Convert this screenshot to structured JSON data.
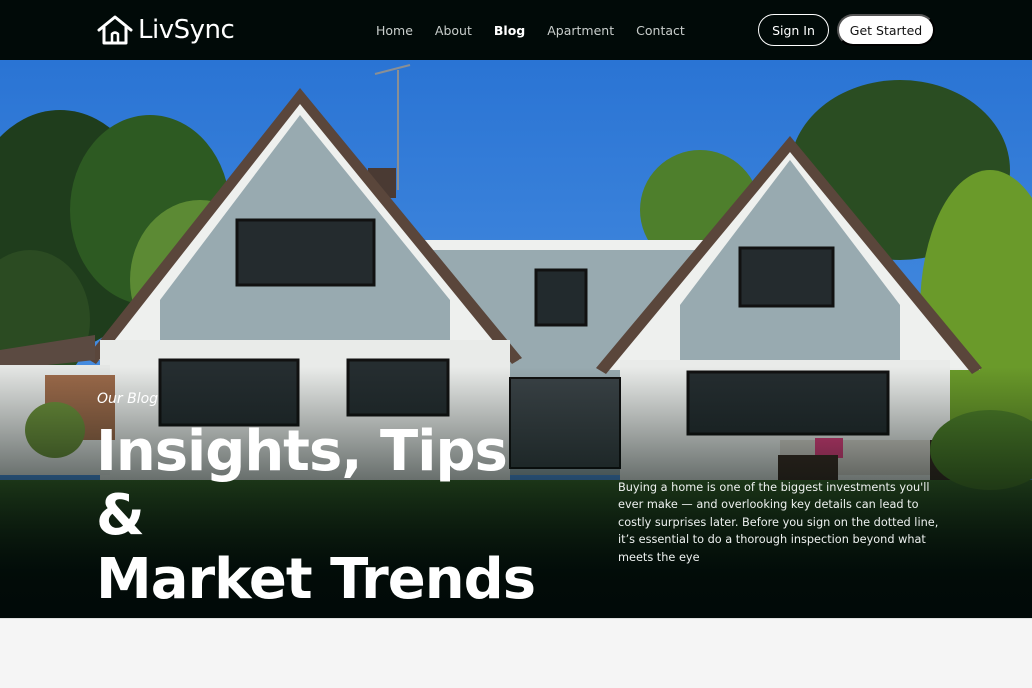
{
  "brand": {
    "name": "LivSync",
    "logo_icon": "house-icon"
  },
  "nav": {
    "links": [
      {
        "label": "Home",
        "active": false
      },
      {
        "label": "About",
        "active": false
      },
      {
        "label": "Blog",
        "active": true
      },
      {
        "label": "Apartment",
        "active": false
      },
      {
        "label": "Contact",
        "active": false
      }
    ],
    "sign_in": "Sign In",
    "get_started": "Get Started"
  },
  "hero": {
    "kicker": "Our Blog",
    "title_line1": "Insights, Tips &",
    "title_line2": "Market Trends",
    "description": "Buying a home is one of the biggest investments you'll ever make — and overlooking key details can lead to costly surprises later. Before you sign on the dotted line, it’s essential to do a thorough inspection beyond what meets the eye",
    "image": "house-photo"
  },
  "colors": {
    "nav_background": "#010a08",
    "hero_fade": "#010a08",
    "siding": "#98aab0",
    "sky": "#2f7fdb",
    "page_background": "#f5f5f5"
  }
}
